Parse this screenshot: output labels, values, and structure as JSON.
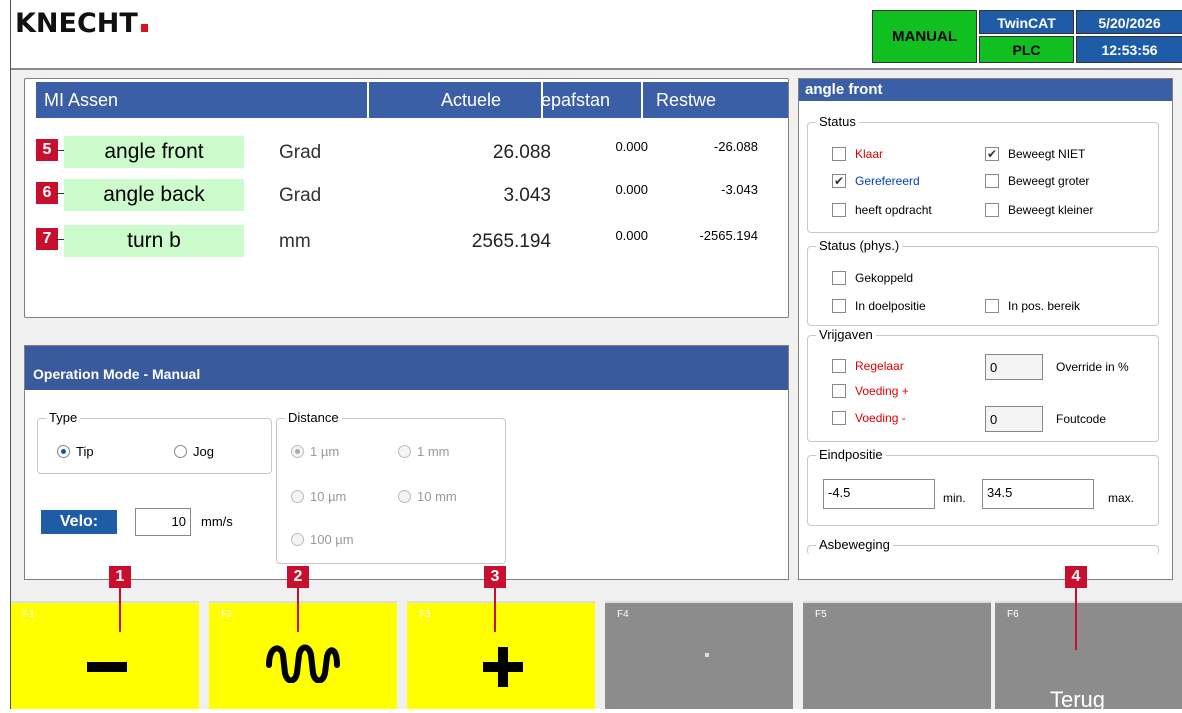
{
  "header": {
    "logo": "KNECHT",
    "mode": "MANUAL",
    "twincat": "TwinCAT",
    "plc": "PLC",
    "date": "5/20/2026",
    "time": "12:53:56"
  },
  "axes_table": {
    "headers": [
      "MI  Assen",
      "Actuele",
      "epafstan",
      "Restwe"
    ],
    "rows": [
      {
        "num": "5",
        "name": "angle front",
        "unit": "Grad",
        "actual": "26.088",
        "dist": "0.000",
        "rest": "-26.088"
      },
      {
        "num": "6",
        "name": "angle back",
        "unit": "Grad",
        "actual": "3.043",
        "dist": "0.000",
        "rest": "-3.043"
      },
      {
        "num": "7",
        "name": "turn b",
        "unit": "mm",
        "actual": "2565.194",
        "dist": "0.000",
        "rest": "-2565.194"
      }
    ]
  },
  "operation": {
    "title": "Operation Mode - Manual",
    "type_title": "Type",
    "type_options": [
      "Tip",
      "Jog"
    ],
    "type_selected": "Tip",
    "distance_title": "Distance",
    "distance_options": [
      "1 µm",
      "1 mm",
      "10 µm",
      "10 mm",
      "100 µm"
    ],
    "distance_selected": "1 µm",
    "velo_label": "Velo:",
    "velo_value": "10",
    "velo_unit": "mm/s"
  },
  "detail": {
    "title": "angle front",
    "status_title": "Status",
    "status": [
      {
        "label": "Klaar",
        "checked": false,
        "color": "#e00000"
      },
      {
        "label": "Beweegt NIET",
        "checked": true,
        "color": "#000000"
      },
      {
        "label": "Gerefereerd",
        "checked": true,
        "color": "#0040c0"
      },
      {
        "label": "Beweegt groter",
        "checked": false,
        "color": "#000000"
      },
      {
        "label": "heeft opdracht",
        "checked": false,
        "color": "#000000"
      },
      {
        "label": "Beweegt kleiner",
        "checked": false,
        "color": "#000000"
      }
    ],
    "phys_title": "Status (phys.)",
    "phys": [
      {
        "label": "Gekoppeld",
        "checked": false
      },
      {
        "label": "In doelpositie",
        "checked": false
      },
      {
        "label": "In pos. bereik",
        "checked": false
      }
    ],
    "release_title": "Vrijgaven",
    "release": [
      {
        "label": "Regelaar",
        "checked": false
      },
      {
        "label": "Voeding +",
        "checked": false
      },
      {
        "label": "Voeding -",
        "checked": false
      }
    ],
    "override_value": "0",
    "override_label": "Override in %",
    "errorcode_value": "0",
    "errorcode_label": "Foutcode",
    "endpos_title": "Eindpositie",
    "min_value": "-4.5",
    "min_label": "min.",
    "max_value": "34.5",
    "max_label": "max.",
    "motion_title": "Asbeweging"
  },
  "fkeys": [
    {
      "key": "F1",
      "symbol": "−",
      "badge": "1"
    },
    {
      "key": "F2",
      "symbol": "jog",
      "badge": "2"
    },
    {
      "key": "F3",
      "symbol": "+",
      "badge": "3"
    },
    {
      "key": "F4",
      "symbol": "",
      "badge": ""
    },
    {
      "key": "F5",
      "symbol": "",
      "badge": ""
    },
    {
      "key": "F6",
      "symbol": "Terug",
      "badge": "4"
    }
  ],
  "colors": {
    "accent_blue": "#3b5fa6",
    "fkey_active": "#ffff00",
    "fkey_inactive": "#8c8c8c",
    "status_green": "#10c020",
    "badge_red": "#c8102e"
  }
}
